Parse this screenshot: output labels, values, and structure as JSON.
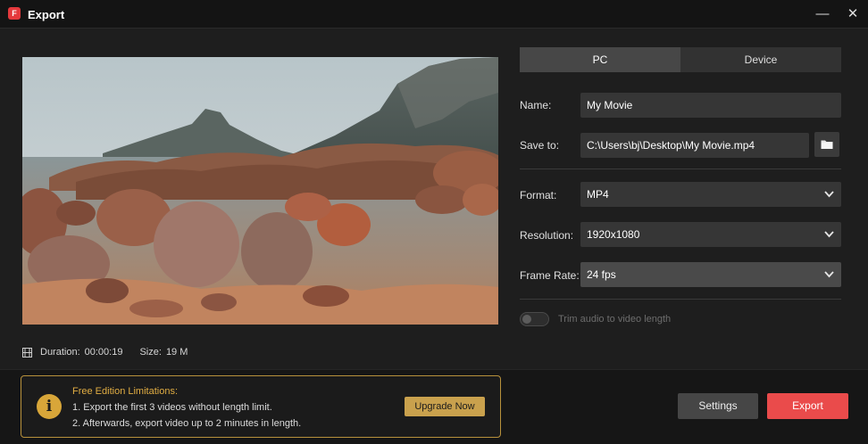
{
  "window": {
    "title": "Export",
    "app_icon_glyph": "F",
    "minimize_glyph": "—",
    "close_glyph": "✕"
  },
  "preview": {
    "duration_label": "Duration:",
    "duration_value": "00:00:19",
    "size_label": "Size:",
    "size_value": "19 M"
  },
  "tabs": [
    {
      "label": "PC",
      "active": true
    },
    {
      "label": "Device",
      "active": false
    }
  ],
  "form": {
    "name_label": "Name:",
    "name_value": "My Movie",
    "save_label": "Save to:",
    "save_value": "C:\\Users\\bj\\Desktop\\My Movie.mp4",
    "format_label": "Format:",
    "format_value": "MP4",
    "resolution_label": "Resolution:",
    "resolution_value": "1920x1080",
    "framerate_label": "Frame Rate:",
    "framerate_value": "24 fps",
    "trim_label": "Trim audio to video length",
    "trim_enabled": false
  },
  "limitations": {
    "title": "Free Edition Limitations:",
    "line1": "1. Export the first 3 videos without length limit.",
    "line2": "2. Afterwards, export video up to 2 minutes in length.",
    "upgrade_label": "Upgrade Now",
    "icon_glyph": "i"
  },
  "actions": {
    "settings_label": "Settings",
    "export_label": "Export"
  },
  "colors": {
    "accent_export": "#ea4b4b",
    "accent_gold": "#c9a14d",
    "background": "#1e1e1e"
  },
  "icons": [
    "app-logo-icon",
    "minimize-icon",
    "close-icon",
    "film-icon",
    "folder-icon",
    "chevron-down-icon",
    "info-icon"
  ]
}
